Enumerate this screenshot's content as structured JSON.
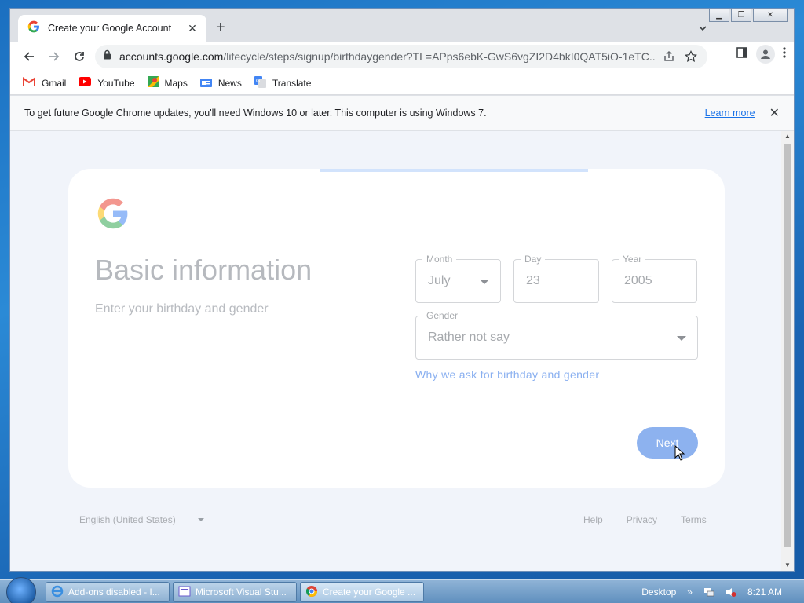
{
  "browser": {
    "tab_title": "Create your Google Account",
    "url_host": "accounts.google.com",
    "url_path": "/lifecycle/steps/signup/birthdaygender?TL=APps6ebK-GwS6vgZI2D4bkI0QAT5iO-1eTC...",
    "bookmarks": [
      {
        "label": "Gmail",
        "icon": "gmail-icon"
      },
      {
        "label": "YouTube",
        "icon": "youtube-icon"
      },
      {
        "label": "Maps",
        "icon": "maps-icon"
      },
      {
        "label": "News",
        "icon": "news-icon"
      },
      {
        "label": "Translate",
        "icon": "translate-icon"
      }
    ],
    "infobar_text": "To get future Google Chrome updates, you'll need Windows 10 or later. This computer is using Windows 7.",
    "infobar_link": "Learn more"
  },
  "page": {
    "title": "Basic information",
    "subtitle": "Enter your birthday and gender",
    "month": {
      "label": "Month",
      "value": "July"
    },
    "day": {
      "label": "Day",
      "value": "23"
    },
    "year": {
      "label": "Year",
      "value": "2005"
    },
    "gender": {
      "label": "Gender",
      "value": "Rather not say"
    },
    "why_link": "Why we ask for birthday and gender",
    "next_label": "Next"
  },
  "footer": {
    "language": "English (United States)",
    "links": [
      "Help",
      "Privacy",
      "Terms"
    ]
  },
  "taskbar": {
    "items": [
      "Add-ons disabled - I...",
      "Microsoft Visual Stu...",
      "Create your Google ..."
    ],
    "desktop_label": "Desktop",
    "time": "8:21 AM"
  },
  "colors": {
    "accent": "#1a73e8",
    "next_button": "#8db2ef",
    "page_bg": "#f1f4fa"
  }
}
